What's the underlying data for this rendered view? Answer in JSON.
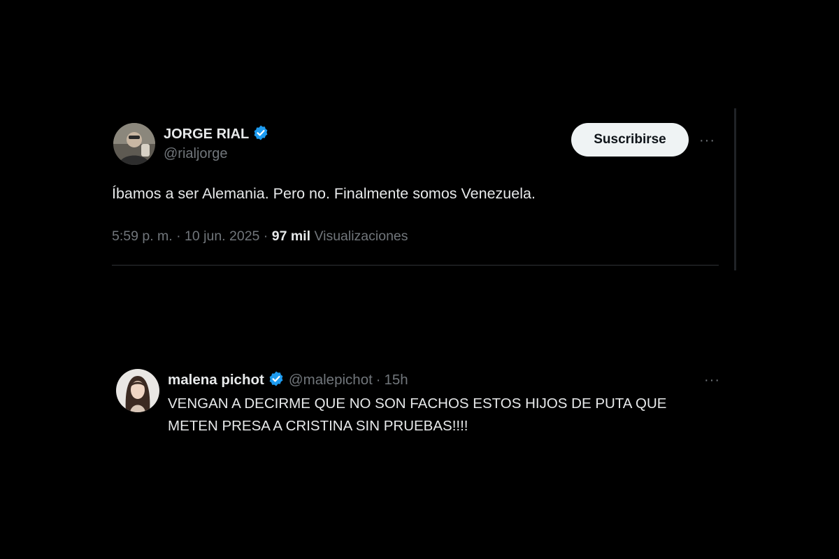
{
  "tweet": {
    "display_name": "JORGE RIAL",
    "handle": "@rialjorge",
    "subscribe_label": "Suscribirse",
    "more_label": "···",
    "text": "Íbamos a ser Alemania. Pero no. Finalmente somos Venezuela.",
    "timestamp": "5:59 p. m. · 10 jun. 2025 ·",
    "views_count": "97 mil",
    "views_label": "Visualizaciones"
  },
  "reply": {
    "display_name": "malena pichot",
    "handle": "@malepichot",
    "separator": "·",
    "time": "15h",
    "more_label": "···",
    "text": "VENGAN A DECIRME QUE NO SON FACHOS ESTOS HIJOS DE PUTA QUE METEN PRESA A CRISTINA SIN PRUEBAS!!!!"
  },
  "colors": {
    "background": "#000000",
    "verified_badge": "#1d9bf0",
    "primary_text": "#e7e9ea",
    "secondary_text": "#71767b",
    "button_bg": "#eff3f4"
  },
  "icons": {
    "verified": "verified-badge-icon",
    "more": "more-options-icon"
  }
}
